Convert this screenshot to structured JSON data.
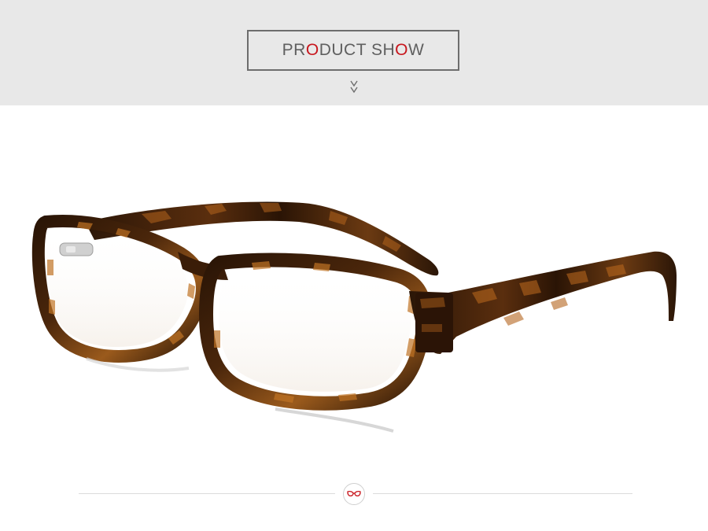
{
  "header": {
    "title_parts": {
      "p1": "PR",
      "p2": "O",
      "p3": "DUCT SH",
      "p4": "O",
      "p5": "W"
    },
    "accent_color": "#c8161d",
    "text_color": "#5f5f5f",
    "band_color": "#e8e8e8"
  },
  "icons": {
    "scroll": "double-chevron-down-icon",
    "divider_logo": "glasses-logo-icon"
  },
  "product_image": {
    "subject": "tortoiseshell-eyeglasses",
    "frame_color": "#3a1f0c",
    "tortoise_accent": "#b5651d"
  }
}
